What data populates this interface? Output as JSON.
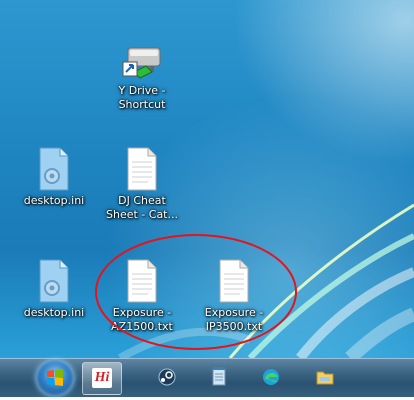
{
  "desktop": {
    "icons": [
      {
        "name": "y-drive-shortcut",
        "line1": "Y Drive -",
        "line2": "Shortcut",
        "kind": "drive-shortcut-icon"
      },
      {
        "name": "desktop-ini-1",
        "line1": "desktop.ini",
        "line2": "",
        "kind": "config-file-icon"
      },
      {
        "name": "dj-cheat-sheet",
        "line1": "DJ Cheat",
        "line2": "Sheet - Cat...",
        "kind": "text-file-icon"
      },
      {
        "name": "desktop-ini-2",
        "line1": "desktop.ini",
        "line2": "",
        "kind": "config-file-icon"
      },
      {
        "name": "exposure-az1500",
        "line1": "Exposure -",
        "line2": "AZ1500.txt",
        "kind": "text-file-icon"
      },
      {
        "name": "exposure-ip3500",
        "line1": "Exposure -",
        "line2": "IP3500.txt",
        "kind": "text-file-icon"
      }
    ],
    "annotation": {
      "shape": "ellipse",
      "color": "#e3141b"
    }
  },
  "taskbar": {
    "start": {
      "icon": "windows-start-icon"
    },
    "buttons": [
      {
        "name": "hi-app",
        "label": "Hi",
        "icon": "hi-app-icon"
      },
      {
        "name": "steam",
        "icon": "steam-icon"
      },
      {
        "name": "notepad",
        "icon": "notepad-icon"
      },
      {
        "name": "edge",
        "icon": "edge-icon"
      },
      {
        "name": "file-explorer",
        "icon": "folder-icon"
      }
    ]
  },
  "colors": {
    "accent": "#2e97cf",
    "annotation": "#e3141b",
    "taskbar": "#3d6684"
  }
}
